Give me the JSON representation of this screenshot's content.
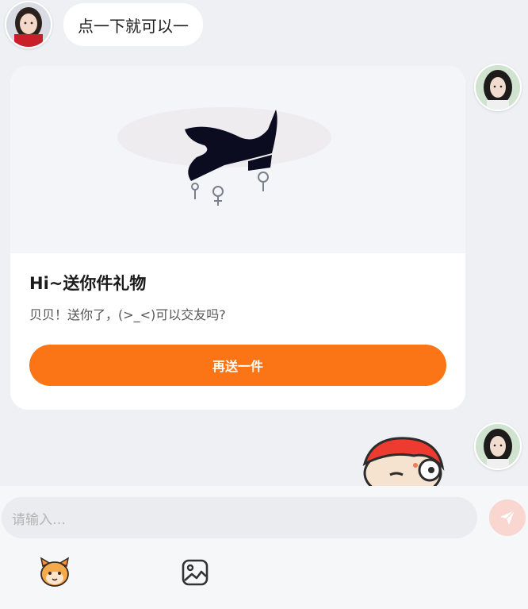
{
  "messages": {
    "incoming_text": "点一下就可以一"
  },
  "gift_card": {
    "title": "Hi~送你件礼物",
    "message": "贝贝！送你了，(>_<)可以交友吗?",
    "resend_label": "再送一件"
  },
  "composer": {
    "placeholder": "请输入…",
    "send_icon": "paper-plane-icon",
    "tools": [
      "sticker-icon",
      "image-icon"
    ]
  },
  "colors": {
    "accent": "#fb7415",
    "send_button_disabled": "#f9d6d0",
    "background": "#eef0f3"
  }
}
